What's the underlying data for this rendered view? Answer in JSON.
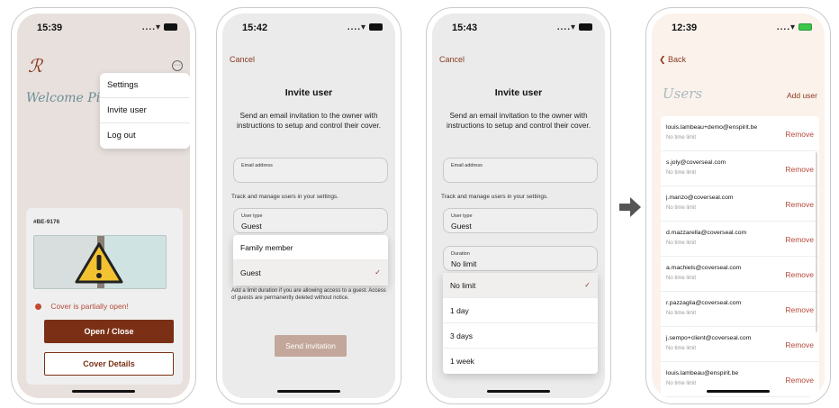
{
  "phone1": {
    "status_time": "15:39",
    "signal": ".... ",
    "welcome": "Welcome Pierre",
    "menu": [
      "Settings",
      "Invite user",
      "Log out"
    ],
    "device_code": "#BE-9176",
    "alert": "Cover is partially open!",
    "primary_button": "Open / Close",
    "secondary_button": "Cover Details",
    "colors": {
      "accent": "#7b3015",
      "warning": "#f2c230",
      "alert": "#c2492f"
    }
  },
  "phone2": {
    "status_time": "15:42",
    "cancel": "Cancel",
    "title": "Invite user",
    "description": "Send an email invitation to the owner with instructions to setup and control their cover.",
    "email_label": "Email address",
    "hint": "Track and manage users in your settings.",
    "user_type_label": "User type",
    "user_type_value": "Guest",
    "options": [
      "Family member",
      "Guest"
    ],
    "selected_option": "Guest",
    "note": "Add a limit duration if you are allowing access to a guest. Access of guests are permanently deleted without notice.",
    "send_button": "Send invitation"
  },
  "phone3": {
    "status_time": "15:43",
    "cancel": "Cancel",
    "title": "Invite user",
    "description": "Send an email invitation to the owner with instructions to setup and control their cover.",
    "email_label": "Email address",
    "hint": "Track and manage users in your settings.",
    "user_type_label": "User type",
    "user_type_value": "Guest",
    "duration_label": "Duration",
    "duration_value": "No limit",
    "options": [
      "No limit",
      "1 day",
      "3 days",
      "1 week"
    ],
    "selected_option": "No limit"
  },
  "phone4": {
    "status_time": "12:39",
    "back": "Back",
    "title": "Users",
    "add_user": "Add user",
    "remove_label": "Remove",
    "users": [
      {
        "email": "louis.lambeau+demo@enspirit.be",
        "limit": "No time limit"
      },
      {
        "email": "s.joly@coverseal.com",
        "limit": "No time limit"
      },
      {
        "email": "j.manzo@coverseal.com",
        "limit": "No time limit"
      },
      {
        "email": "d.mazzarella@coverseal.com",
        "limit": "No time limit"
      },
      {
        "email": "a.machiels@coverseal.com",
        "limit": "No time limit"
      },
      {
        "email": "r.pazzaglia@coverseal.com",
        "limit": "No time limit"
      },
      {
        "email": "j.sempo+client@coverseal.com",
        "limit": "No time limit"
      },
      {
        "email": "louis.lambeau@enspirit.be",
        "limit": "No time limit"
      }
    ]
  }
}
